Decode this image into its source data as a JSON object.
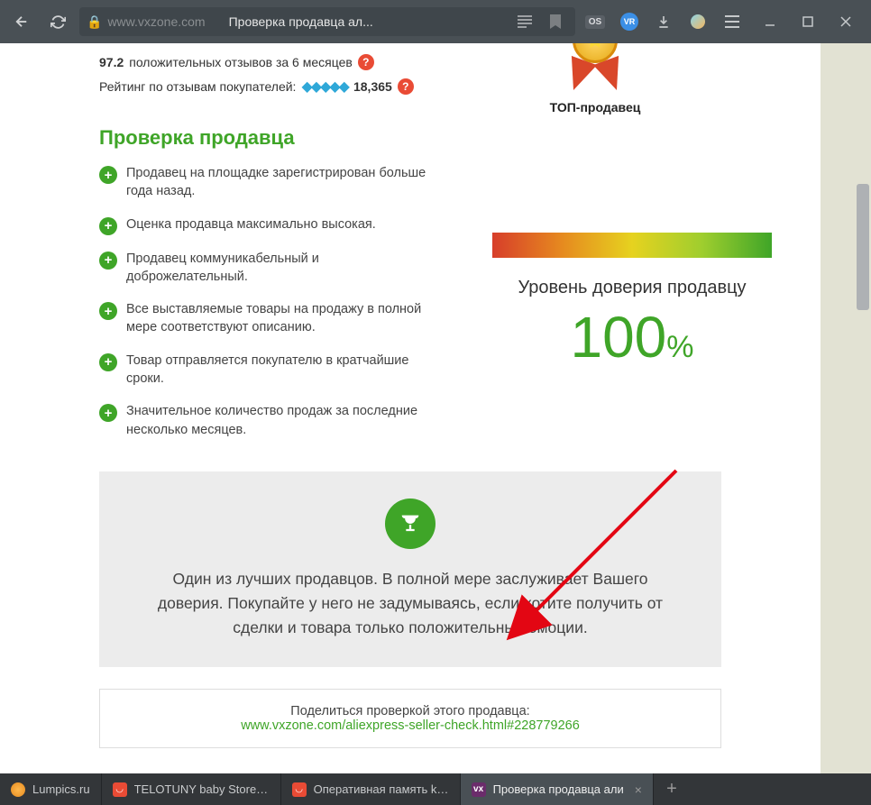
{
  "browser": {
    "url_host": "www.vxzone.com",
    "tab_title": "Проверка продавца ал..."
  },
  "ratings": {
    "positive_pct": "97.2",
    "positive_label": "положительных отзывов за 6 месяцев",
    "buyer_label": "Рейтинг по отзывам покупателей:",
    "buyer_score": "18,365"
  },
  "top_seller": "ТОП-продавец",
  "section_title": "Проверка продавца",
  "checks": [
    "Продавец на площадке зарегистрирован больше года назад.",
    "Оценка продавца максимально высокая.",
    "Продавец коммуникабельный и доброжелательный.",
    "Все выставляемые товары на продажу в полной мере соответствуют описанию.",
    "Товар отправляется покупателю в кратчайшие сроки.",
    "Значительное количество продаж за последние несколько месяцев."
  ],
  "trust": {
    "label": "Уровень доверия продавцу",
    "value": "100",
    "sign": "%"
  },
  "verdict": "Один из лучших продавцов. В полной мере заслуживает Вашего доверия. Покупайте у него не задумываясь, если хотите получить от сделки и товара только положительные эмоции.",
  "share": {
    "label": "Поделиться проверкой этого продавца:",
    "url": "www.vxzone.com/aliexpress-seller-check.html#228779266"
  },
  "tabs": [
    {
      "label": "Lumpics.ru",
      "fav": "lump"
    },
    {
      "label": "TELOTUNY baby Store - Sm",
      "fav": "ali"
    },
    {
      "label": "Оперативная память kings",
      "fav": "ali"
    },
    {
      "label": "Проверка продавца али",
      "fav": "vx",
      "active": true
    }
  ]
}
